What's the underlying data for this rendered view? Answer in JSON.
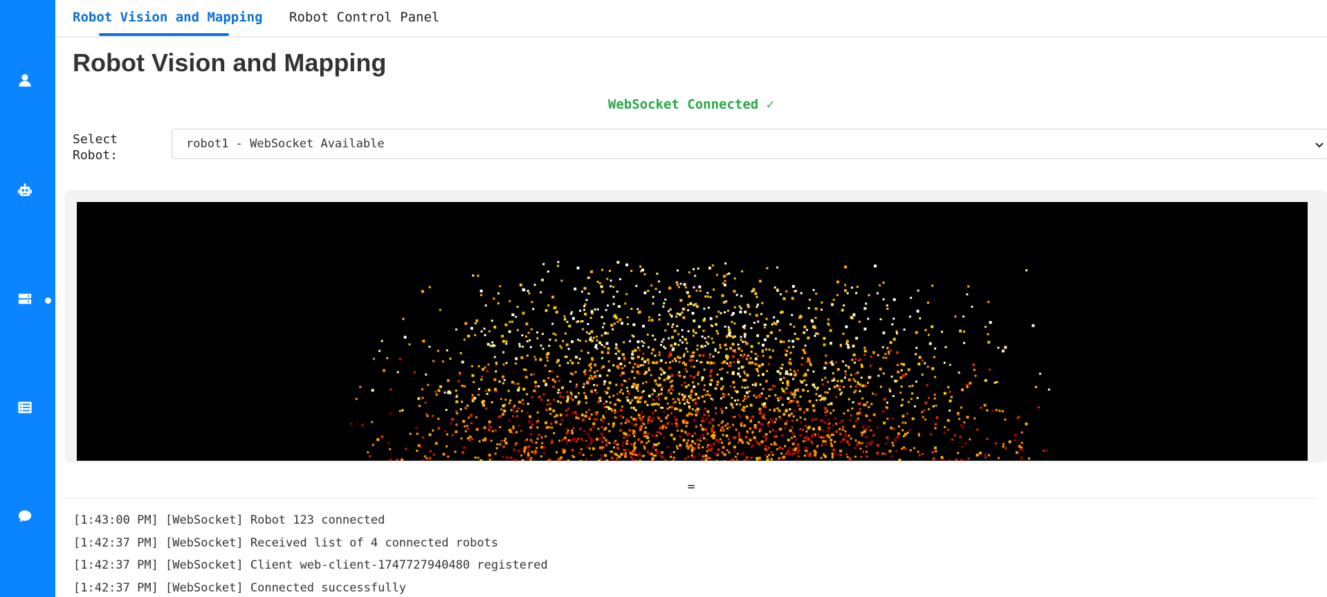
{
  "sidebar": {
    "items": [
      {
        "icon": "user-icon"
      },
      {
        "icon": "robot-icon"
      },
      {
        "icon": "server-icon",
        "active": true
      },
      {
        "icon": "list-icon"
      },
      {
        "icon": "chat-icon"
      }
    ]
  },
  "tabs": [
    {
      "label": "Robot Vision and Mapping",
      "active": true
    },
    {
      "label": "Robot Control Panel",
      "active": false
    }
  ],
  "page": {
    "title": "Robot Vision and Mapping"
  },
  "websocket": {
    "status": "WebSocket Connected ✓",
    "status_color": "#28a745"
  },
  "robot_select": {
    "label": "Select Robot:",
    "selected": "robot1 - WebSocket Available"
  },
  "visualization": {
    "background": "#000000",
    "palette": [
      "#ffffff",
      "#fff4a8",
      "#ffd000",
      "#ffae00",
      "#ff8c00",
      "#d62b00",
      "#a30000"
    ]
  },
  "resize_handle": {
    "glyph": "="
  },
  "logs": [
    "[1:43:00 PM] [WebSocket] Robot 123 connected",
    "[1:42:37 PM] [WebSocket] Received list of 4 connected robots",
    "[1:42:37 PM] [WebSocket] Client web-client-1747727940480 registered",
    "[1:42:37 PM] [WebSocket] Connected successfully"
  ],
  "colors": {
    "sidebar": "#0a84ff",
    "tab_active": "#0a6fd6"
  }
}
